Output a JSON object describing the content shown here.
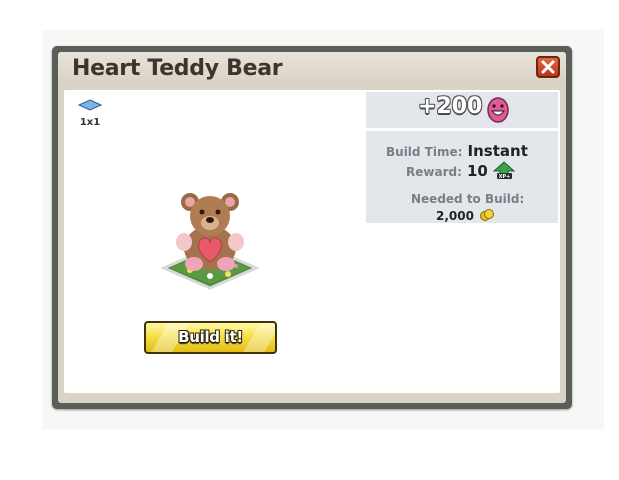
{
  "dialog": {
    "title": "Heart Teddy Bear",
    "close_icon": "close-icon"
  },
  "item": {
    "size_label": "1x1",
    "size_icon": "tile-icon",
    "image_icon": "heart-teddy-bear-icon"
  },
  "cost": {
    "value": "+200",
    "currency_icon": "love-face-icon",
    "currency_color": "#e05b97"
  },
  "details": {
    "build_time_label": "Build Time:",
    "build_time_value": "Instant",
    "reward_label": "Reward:",
    "reward_value": "10",
    "reward_icon": "xp-icon",
    "needed_label": "Needed to Build:",
    "needed_value": "2,000",
    "needed_icon": "coin-icon"
  },
  "actions": {
    "build_label": "Build it!"
  },
  "colors": {
    "frame": "#5a5e58",
    "panel": "#e3e7ec",
    "button": "#f6e04a",
    "close": "#c8452a"
  }
}
